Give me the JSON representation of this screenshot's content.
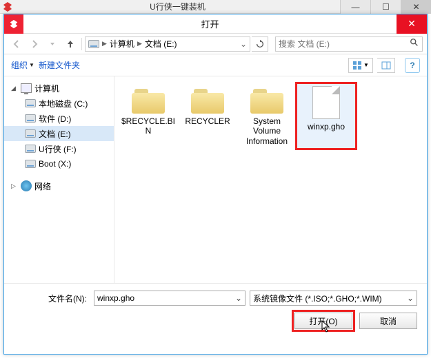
{
  "backwin": {
    "title": "U行侠一键装机"
  },
  "dialog": {
    "title": "打开",
    "breadcrumb": {
      "root": "计算机",
      "current": "文档 (E:)"
    },
    "search_placeholder": "搜索 文档 (E:)",
    "toolbar": {
      "organize": "组织",
      "newfolder": "新建文件夹"
    },
    "tree": {
      "computer": "计算机",
      "drives": [
        {
          "label": "本地磁盘 (C:)"
        },
        {
          "label": "软件 (D:)"
        },
        {
          "label": "文档 (E:)"
        },
        {
          "label": "U行侠 (F:)"
        },
        {
          "label": "Boot (X:)"
        }
      ],
      "network": "网络"
    },
    "files": [
      {
        "name": "$RECYCLE.BIN",
        "type": "folder"
      },
      {
        "name": "RECYCLER",
        "type": "folder"
      },
      {
        "name": "System Volume Information",
        "type": "folder"
      },
      {
        "name": "winxp.gho",
        "type": "file",
        "selected": true
      }
    ],
    "filename_label": "文件名(N):",
    "filename_value": "winxp.gho",
    "filter_value": "系统镜像文件 (*.ISO;*.GHO;*.WIM)",
    "open_btn": "打开(O)",
    "cancel_btn": "取消"
  }
}
